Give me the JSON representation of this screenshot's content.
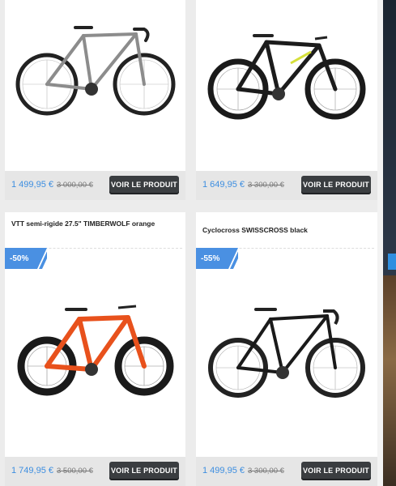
{
  "products": [
    {
      "title": "",
      "price": "1 499,95 €",
      "old_price": "3 000,00 €",
      "button": "VOIR LE PRODUIT",
      "frame_color": "#8c8c8c",
      "accent": "#6b6b6b"
    },
    {
      "title": "",
      "price": "1 649,95 €",
      "old_price": "3 300,00 €",
      "button": "VOIR LE PRODUIT",
      "frame_color": "#1c1c1c",
      "accent": "#d6e03a"
    },
    {
      "title": "VTT semi-rigide 27.5\" TIMBERWOLF orange",
      "discount": "-50%",
      "price": "1 749,95 €",
      "old_price": "3 500,00 €",
      "button": "VOIR LE PRODUIT",
      "frame_color": "#e8511c",
      "accent": "#c0430f"
    },
    {
      "title": "Cyclocross SWISSCROSS black",
      "discount": "-55%",
      "price": "1 499,95 €",
      "old_price": "3 300,00 €",
      "button": "VOIR LE PRODUIT",
      "frame_color": "#1a1a1a",
      "accent": "#7a7a7a"
    }
  ],
  "colors": {
    "price": "#3d8ee0",
    "badge": "#4a90e2",
    "button": "#3a3d40"
  }
}
